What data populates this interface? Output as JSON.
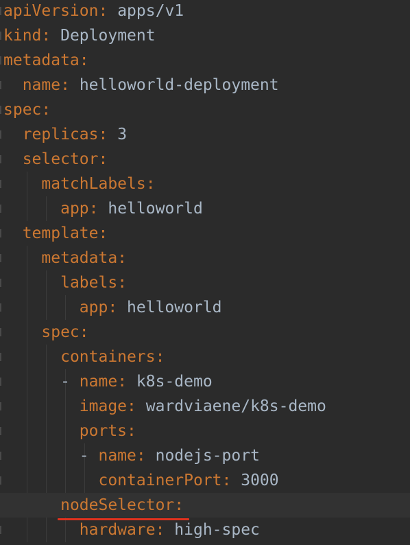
{
  "editor": {
    "lines": [
      {
        "indent": "",
        "dash": "",
        "key": "apiVersion",
        "value": "apps/v1"
      },
      {
        "indent": "",
        "dash": "",
        "key": "kind",
        "value": "Deployment"
      },
      {
        "indent": "",
        "dash": "",
        "key": "metadata",
        "value": ""
      },
      {
        "indent": "  ",
        "dash": "",
        "key": "name",
        "value": "helloworld-deployment"
      },
      {
        "indent": "",
        "dash": "",
        "key": "spec",
        "value": ""
      },
      {
        "indent": "  ",
        "dash": "",
        "key": "replicas",
        "value": "3"
      },
      {
        "indent": "  ",
        "dash": "",
        "key": "selector",
        "value": ""
      },
      {
        "indent": "    ",
        "dash": "",
        "key": "matchLabels",
        "value": ""
      },
      {
        "indent": "      ",
        "dash": "",
        "key": "app",
        "value": "helloworld"
      },
      {
        "indent": "  ",
        "dash": "",
        "key": "template",
        "value": ""
      },
      {
        "indent": "    ",
        "dash": "",
        "key": "metadata",
        "value": ""
      },
      {
        "indent": "      ",
        "dash": "",
        "key": "labels",
        "value": ""
      },
      {
        "indent": "        ",
        "dash": "",
        "key": "app",
        "value": "helloworld"
      },
      {
        "indent": "    ",
        "dash": "",
        "key": "spec",
        "value": ""
      },
      {
        "indent": "      ",
        "dash": "",
        "key": "containers",
        "value": ""
      },
      {
        "indent": "      ",
        "dash": "- ",
        "key": "name",
        "value": "k8s-demo"
      },
      {
        "indent": "        ",
        "dash": "",
        "key": "image",
        "value": "wardviaene/k8s-demo"
      },
      {
        "indent": "        ",
        "dash": "",
        "key": "ports",
        "value": ""
      },
      {
        "indent": "        ",
        "dash": "- ",
        "key": "name",
        "value": "nodejs-port"
      },
      {
        "indent": "          ",
        "dash": "",
        "key": "containerPort",
        "value": "3000"
      },
      {
        "indent": "      ",
        "dash": "",
        "key": "nodeSelector",
        "value": ""
      },
      {
        "indent": "        ",
        "dash": "",
        "key": "hardware",
        "value": "high-spec"
      }
    ],
    "current_line_index": 20,
    "error_line_index": 20
  },
  "colors": {
    "background": "#2b2b2b",
    "key": "#cc7832",
    "value": "#a9b7c6",
    "error_underline": "#e0321e",
    "current_line": "#323232"
  }
}
